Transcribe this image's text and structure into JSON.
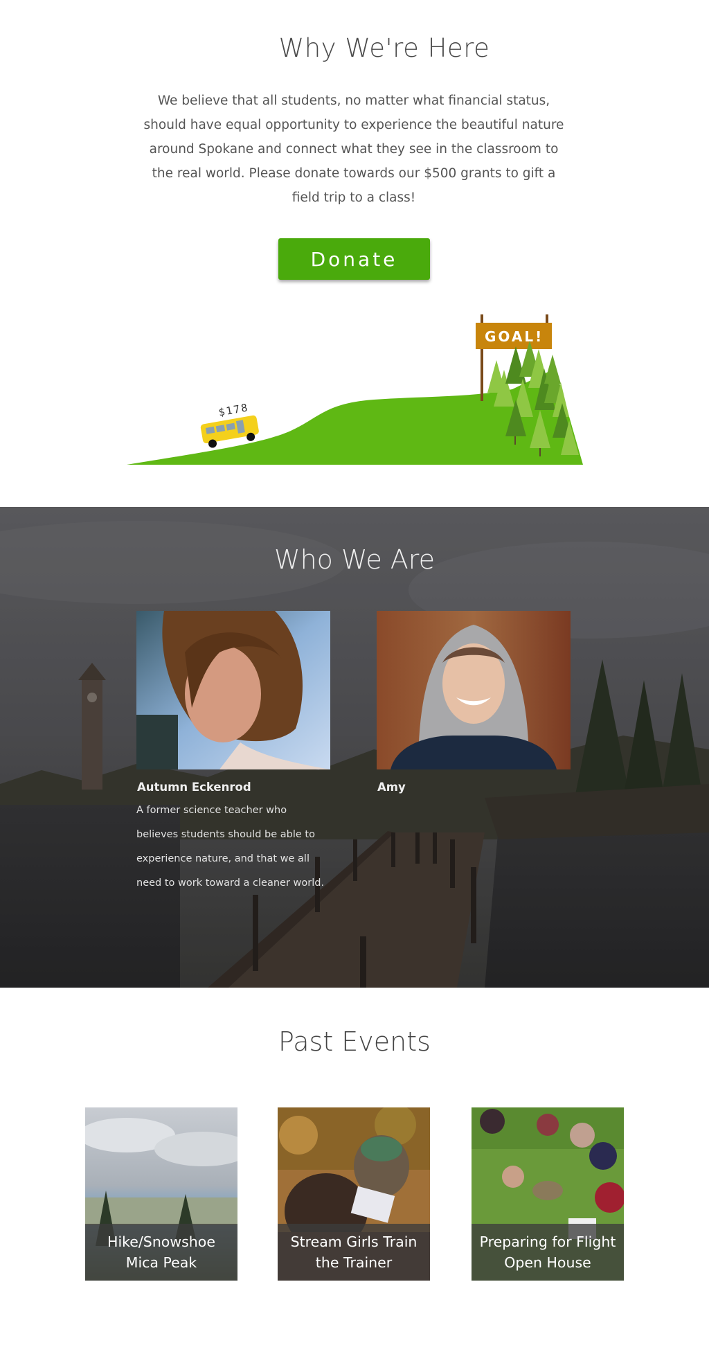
{
  "why": {
    "title": "Why We're Here",
    "text": "We believe that all students, no matter what financial status, should have equal opportunity to experience the beautiful nature around Spokane and connect what they see in the classroom to the real world. Please donate towards our $500 grants to gift a field trip to a class!",
    "donate_label": "Donate",
    "progress": {
      "amount_label": "$178",
      "goal_label": "GOAL!",
      "raised": 178,
      "goal": 500
    }
  },
  "who": {
    "title": "Who We Are",
    "members": [
      {
        "name": "Autumn Eckenrod",
        "bio": "A former science teacher who believes students should be able to experience nature, and that we all need to work toward a cleaner world."
      },
      {
        "name": "Amy",
        "bio": ""
      }
    ]
  },
  "past": {
    "title": "Past Events",
    "events": [
      {
        "title": "Hike/Snowshoe\nMica Peak"
      },
      {
        "title": "Stream Girls Train\nthe Trainer"
      },
      {
        "title": "Preparing for Flight\nOpen House"
      }
    ]
  },
  "colors": {
    "donate_green": "#4aaa0c",
    "hill_green": "#5fb814",
    "goal_orange": "#c8850c",
    "bus_yellow": "#f4d01c"
  }
}
